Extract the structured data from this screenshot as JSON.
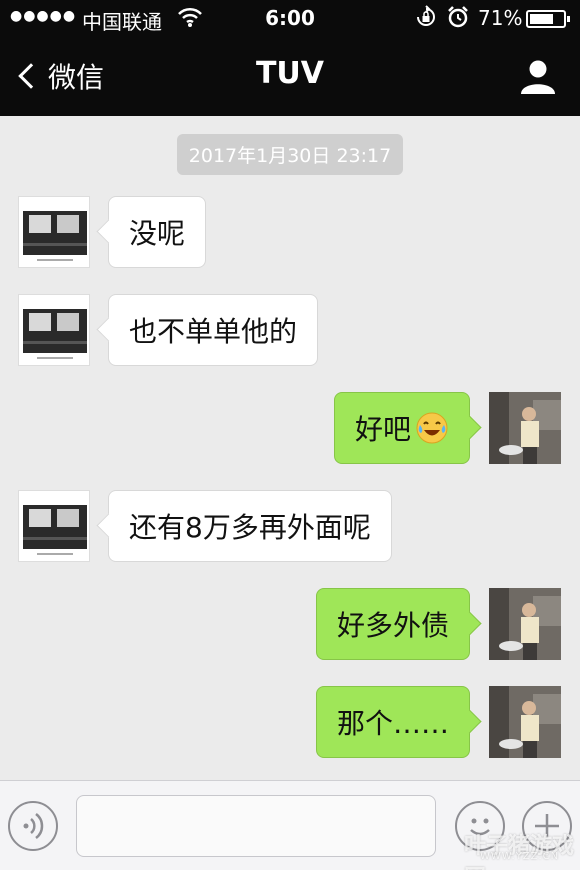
{
  "status_bar": {
    "signal": "●●●●●",
    "carrier": "中国联通",
    "time": "6:00",
    "battery_percent": "71%",
    "battery_level": 0.71,
    "icons": [
      "signal-dots-icon",
      "wifi-icon",
      "orientation-lock-icon",
      "alarm-icon",
      "battery-icon"
    ]
  },
  "nav": {
    "back_label": "微信",
    "title": "TUV",
    "right_icon": "person-icon"
  },
  "timestamp": "2017年1月30日 23:17",
  "messages": [
    {
      "side": "left",
      "text": "没呢"
    },
    {
      "side": "left",
      "text": "也不单单他的"
    },
    {
      "side": "right",
      "text": "好吧",
      "emoji": "laugh-cry-emoji"
    },
    {
      "side": "left",
      "text": "还有8万多再外面呢"
    },
    {
      "side": "right",
      "text": "好多外债"
    },
    {
      "side": "right",
      "text": "那个……"
    }
  ],
  "input_bar": {
    "input_value": "",
    "icons": [
      "voice-icon",
      "emoji-icon",
      "plus-icon"
    ]
  },
  "watermark": {
    "text": "叶子猪游戏网",
    "url": "WWW.YZZ.CN"
  },
  "colors": {
    "header_bg": "#0b0b0b",
    "chat_bg": "#ebebeb",
    "sent_bubble": "#9fe658",
    "received_bubble": "#ffffff"
  }
}
